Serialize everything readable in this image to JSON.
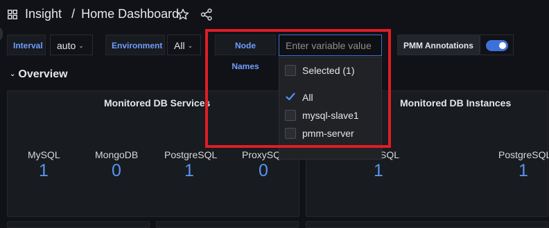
{
  "header": {
    "folder": "Insight",
    "separator": "/",
    "title": "Home Dashboard"
  },
  "variables": {
    "interval": {
      "label": "Interval",
      "value": "auto"
    },
    "environment": {
      "label": "Environment",
      "value": "All"
    },
    "node_names": {
      "label": "Node Names",
      "placeholder": "Enter variable value"
    },
    "pmm_annotations": {
      "label": "PMM Annotations",
      "enabled": true
    }
  },
  "row": {
    "title": "Overview"
  },
  "dropdown": {
    "selected_label": "Selected (1)",
    "options": [
      {
        "label": "All",
        "checked": true
      },
      {
        "label": "mysql-slave1",
        "checked": false
      },
      {
        "label": "pmm-server",
        "checked": false
      }
    ]
  },
  "panels": {
    "services": {
      "title": "Monitored DB Services",
      "stats": [
        {
          "label": "MySQL",
          "value": "1"
        },
        {
          "label": "MongoDB",
          "value": "0"
        },
        {
          "label": "PostgreSQL",
          "value": "1"
        },
        {
          "label": "ProxySQL",
          "value": "0"
        }
      ]
    },
    "instances": {
      "title": "Monitored DB Instances",
      "stats": [
        {
          "label": "SQL",
          "value": "1"
        },
        {
          "label": "PostgreSQL",
          "value": "1"
        }
      ]
    }
  },
  "colors": {
    "accent": "#3d71d9",
    "stat_value": "#5794f2",
    "highlight": "#e01d25",
    "background": "#111217",
    "panel": "#181b1f"
  }
}
